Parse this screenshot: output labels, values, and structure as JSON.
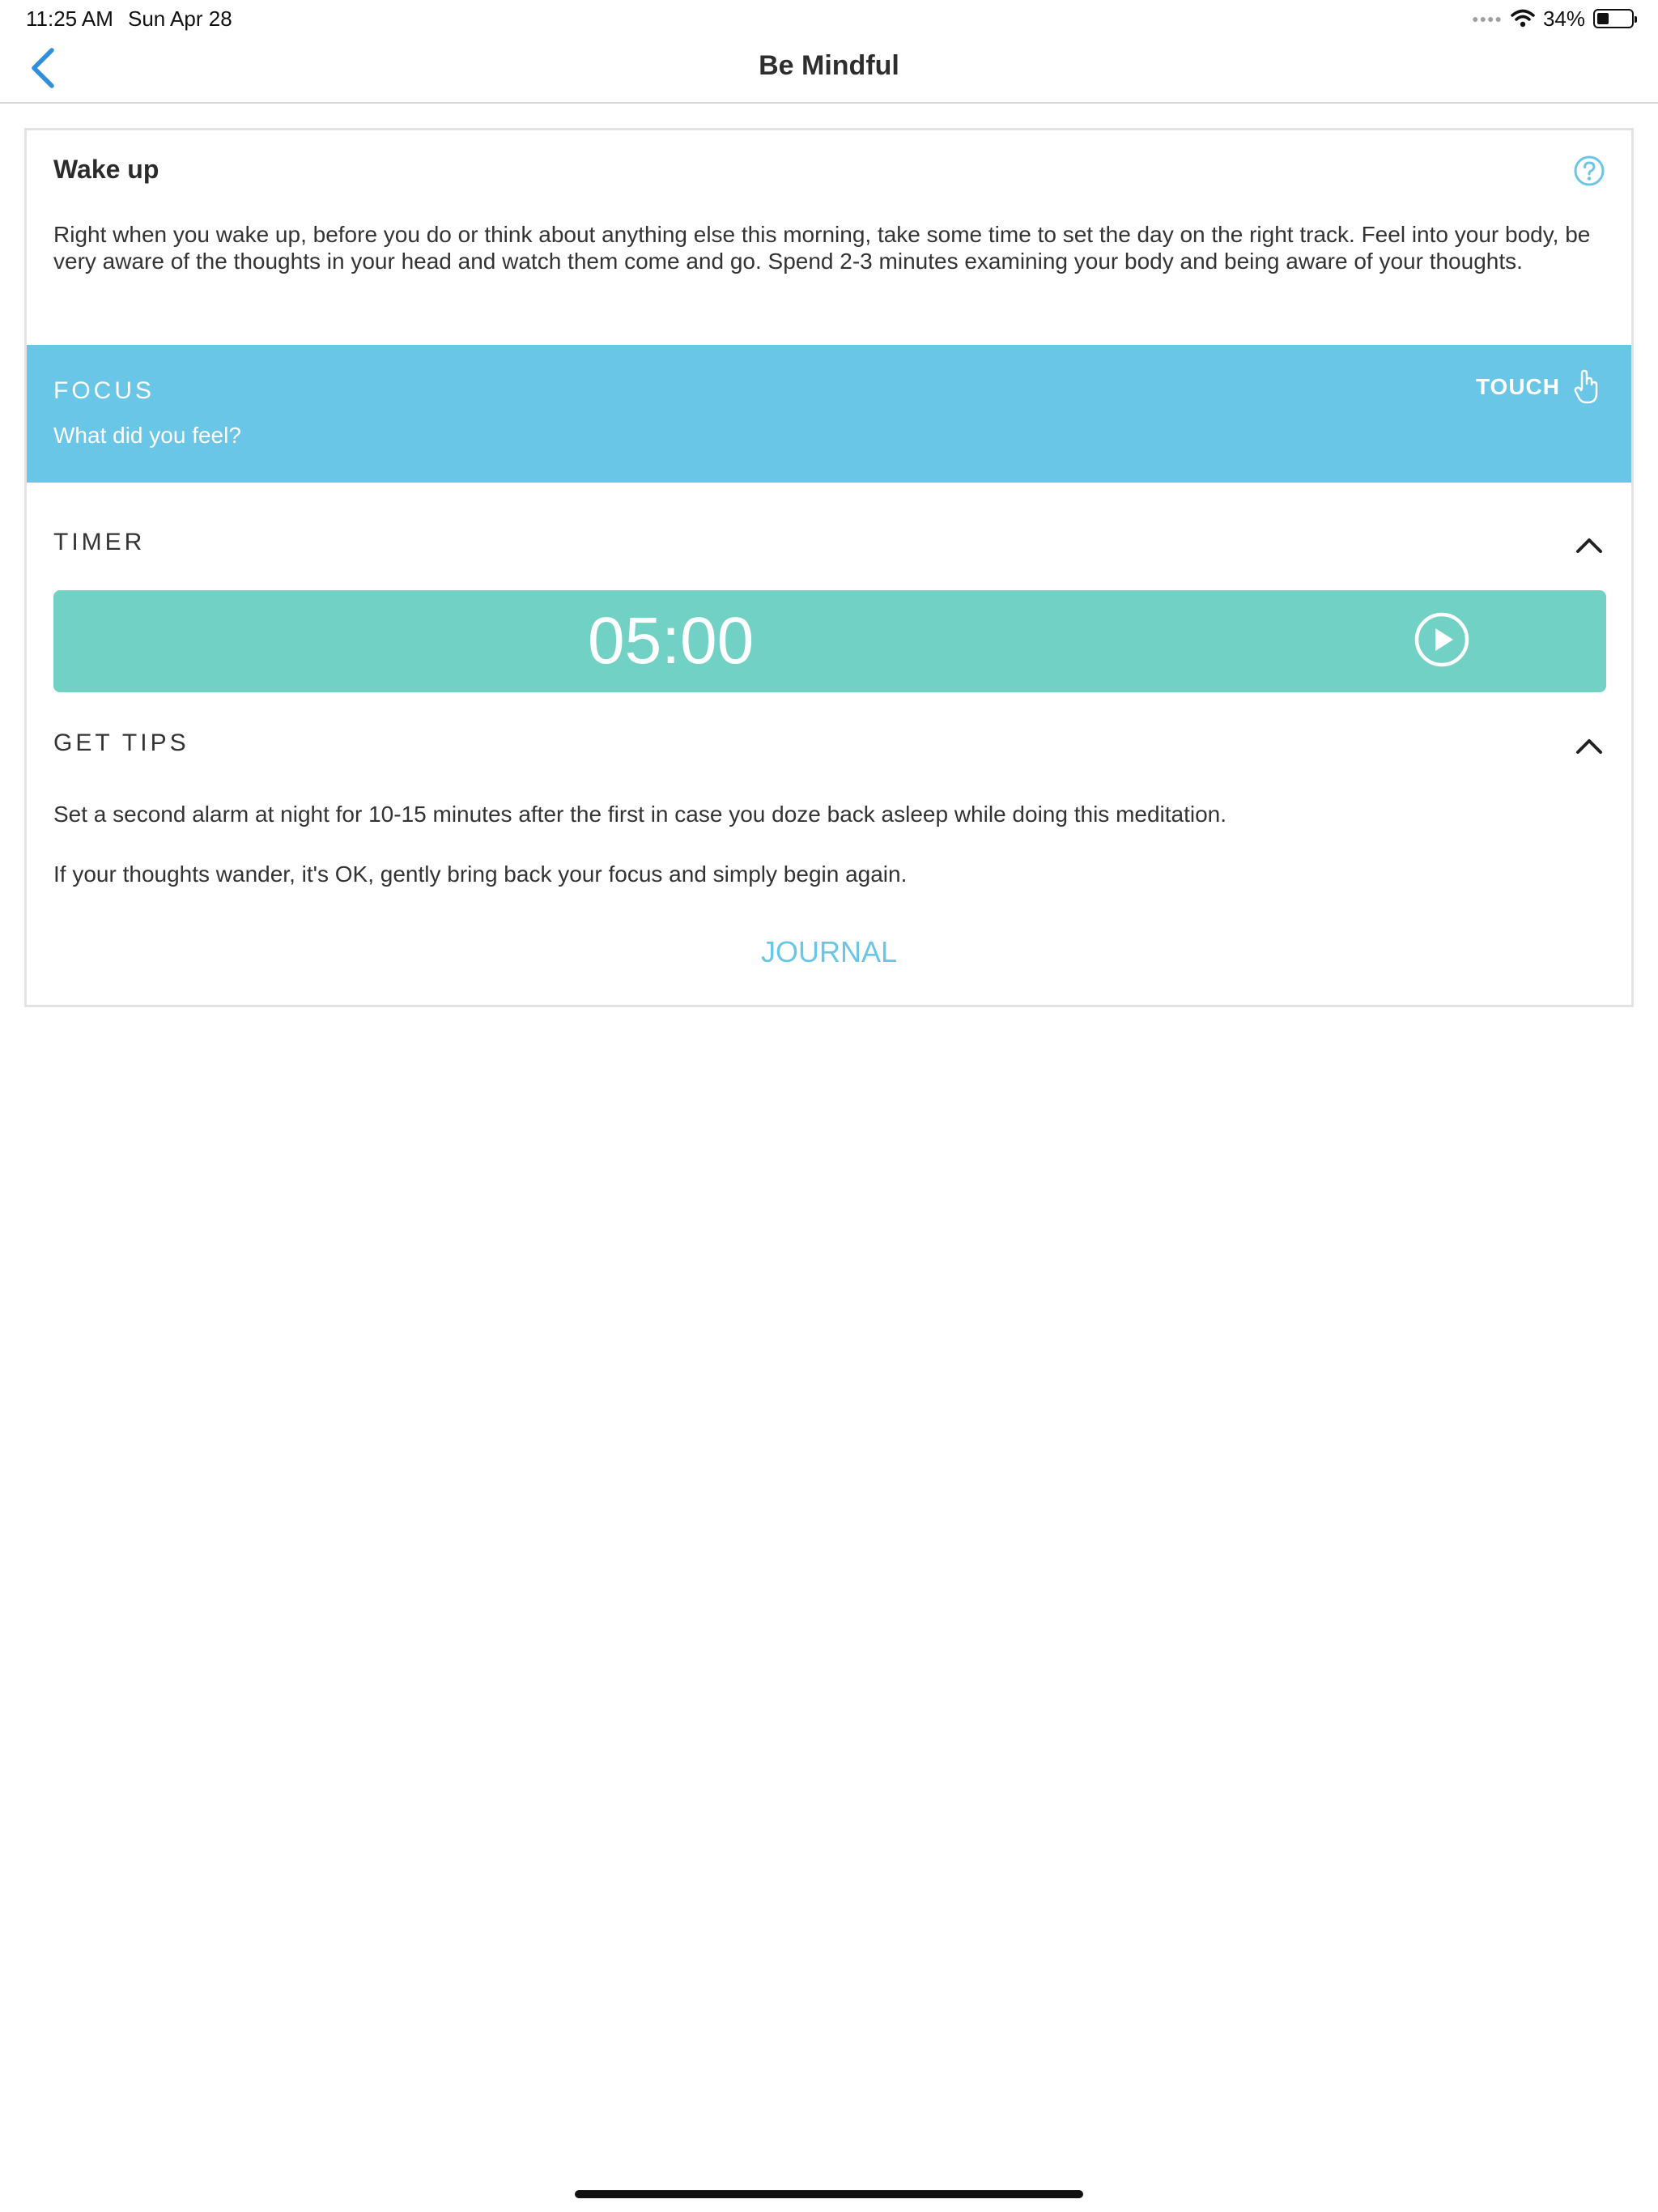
{
  "status_bar": {
    "time": "11:25 AM",
    "date": "Sun Apr 28",
    "battery_percent_label": "34%",
    "battery_level": 0.34,
    "wifi_icon": "wifi-icon",
    "signal_icon": "signal-dots-icon"
  },
  "nav": {
    "title": "Be Mindful",
    "back_icon": "chevron-left-icon",
    "accent_color": "#2f8fd8"
  },
  "card": {
    "title": "Wake up",
    "help_icon": "question-circle-icon",
    "description": "Right when you wake up, before you do or think about anything else this morning, take some time to set the day on the right track. Feel into your body, be very aware of the thoughts in your head and watch them come and go. Spend 2-3 minutes examining your body and being aware of your thoughts."
  },
  "focus": {
    "label": "FOCUS",
    "question": "What did you feel?",
    "touch_label": "TOUCH",
    "touch_icon": "hand-pointer-icon",
    "color": "#6ac6e6"
  },
  "timer": {
    "label": "TIMER",
    "value": "05:00",
    "play_icon": "play-circle-icon",
    "collapse_icon": "chevron-up-icon",
    "color": "#72d1c5"
  },
  "tips": {
    "label": "GET TIPS",
    "collapse_icon": "chevron-up-icon",
    "items": [
      "Set a second alarm at night for 10-15 minutes after the first in case you doze back asleep while doing this meditation.",
      "If your thoughts wander, it's OK, gently bring back your focus and simply begin again."
    ]
  },
  "journal_label": "JOURNAL"
}
